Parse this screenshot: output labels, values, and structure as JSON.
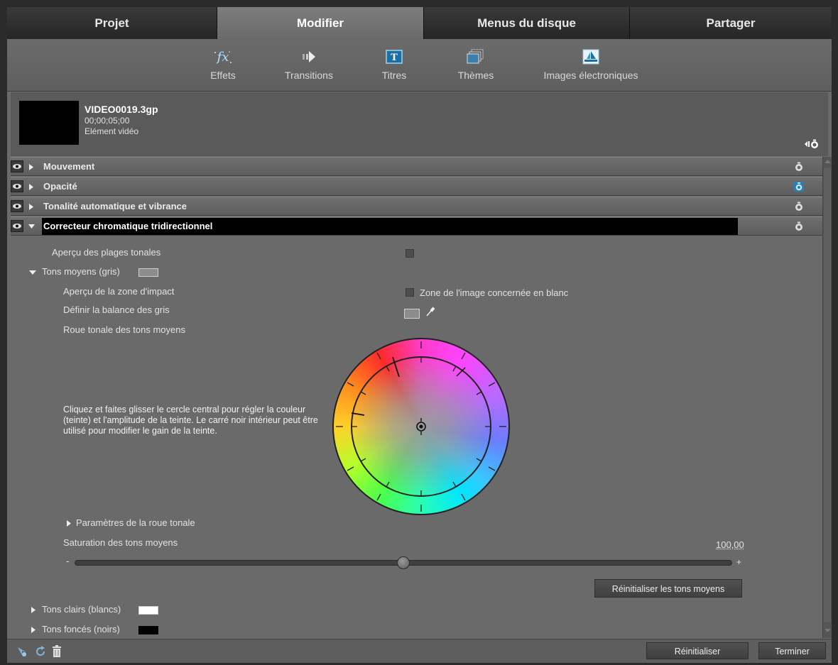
{
  "tabs": [
    {
      "label": "Projet"
    },
    {
      "label": "Modifier"
    },
    {
      "label": "Menus du disque"
    },
    {
      "label": "Partager"
    }
  ],
  "toolbar": [
    {
      "label": "Effets",
      "icon": "fx-icon"
    },
    {
      "label": "Transitions",
      "icon": "transition-arrow-icon"
    },
    {
      "label": "Titres",
      "icon": "titles-icon"
    },
    {
      "label": "Thèmes",
      "icon": "themes-icon"
    },
    {
      "label": "Images électroniques",
      "icon": "sailboat-icon"
    }
  ],
  "clip": {
    "name": "VIDEO0019.3gp",
    "duration": "00;00;05;00",
    "type": "Elément vidéo"
  },
  "effects": [
    {
      "label": "Mouvement"
    },
    {
      "label": "Opacité"
    },
    {
      "label": "Tonalité automatique et vibrance"
    },
    {
      "label": "Correcteur chromatique tridirectionnel"
    }
  ],
  "props": {
    "tonal_preview": "Aperçu des plages tonales",
    "midtones": "Tons moyens (gris)",
    "impact_preview": "Aperçu de la zone d'impact",
    "impact_label": "Zone de l'image concernée en blanc",
    "gray_balance": "Définir la balance des gris",
    "wheel_label": "Roue tonale des tons moyens",
    "wheel_desc": "Cliquez et faites glisser le cercle central pour régler la couleur (teinte) et l'amplitude de la teinte. Le carré noir intérieur peut être utilisé pour modifier le gain de la teinte.",
    "wheel_params": "Paramètres de la roue tonale",
    "saturation": "Saturation des tons moyens",
    "saturation_value": "100,00",
    "slider_min": "-",
    "slider_max": "+",
    "reset_midtones": "Réinitialiser les tons moyens",
    "highlights": "Tons clairs (blancs)",
    "shadows": "Tons foncés (noirs)"
  },
  "footer": {
    "reset": "Réinitialiser",
    "done": "Terminer"
  },
  "colors": {
    "accent": "#2a7fb5",
    "midtone_swatch": "#8c8c8c",
    "highlight_swatch": "#ffffff",
    "shadow_swatch": "#000000"
  }
}
